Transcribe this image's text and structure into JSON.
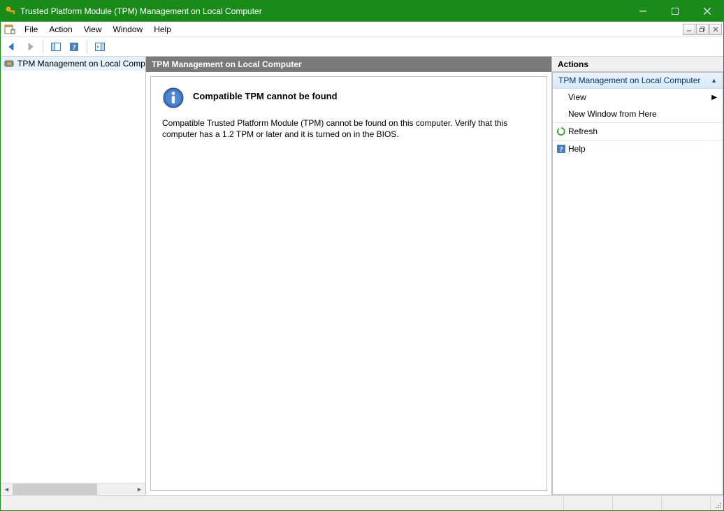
{
  "window": {
    "title": "Trusted Platform Module (TPM) Management on Local Computer"
  },
  "menu": {
    "items": [
      "File",
      "Action",
      "View",
      "Window",
      "Help"
    ]
  },
  "tree": {
    "root_label": "TPM Management on Local Comp"
  },
  "center": {
    "header": "TPM Management on Local Computer",
    "info_title": "Compatible TPM cannot be found",
    "info_body": "Compatible Trusted Platform Module (TPM) cannot be found on this computer. Verify that this computer has a 1.2 TPM or later and it is turned on in the BIOS."
  },
  "actions": {
    "pane_title": "Actions",
    "group_title": "TPM Management on Local Computer",
    "items": {
      "view": "View",
      "new_window": "New Window from Here",
      "refresh": "Refresh",
      "help": "Help"
    }
  }
}
